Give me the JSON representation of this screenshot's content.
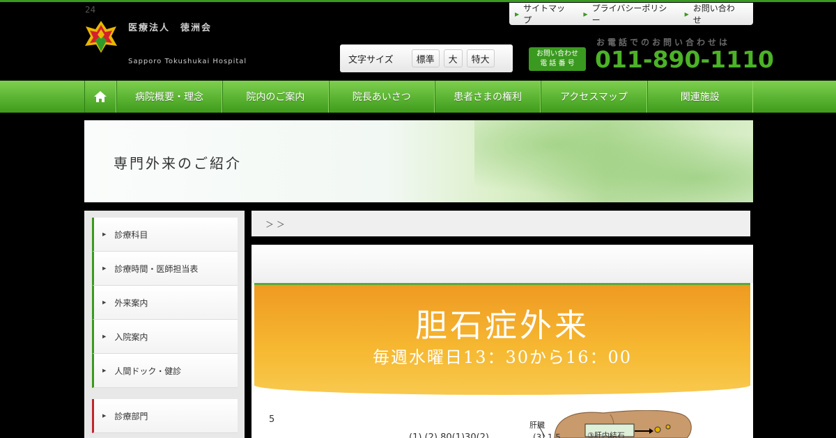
{
  "header": {
    "corner_number": "24",
    "org_name": "医療法人　徳洲会",
    "org_name_en": "Sapporo Tokushukai Hospital",
    "utility_links": [
      "サイトマップ",
      "プライバシーポリシー",
      "お問い合わせ"
    ],
    "font_size": {
      "label": "文字サイズ",
      "options": [
        "標準",
        "大",
        "特大"
      ]
    },
    "phone": {
      "badge_line1": "お問い合わせ",
      "badge_line2": "電 話 番 号",
      "caption": "お電話でのお問い合わせは",
      "number": "011-890-1110"
    }
  },
  "nav": {
    "home_icon": "home-icon",
    "items": [
      "病院概要・理念",
      "院内のご案内",
      "院長あいさつ",
      "患者さまの権利",
      "アクセスマップ",
      "関連施設"
    ]
  },
  "banner": {
    "title": "専門外来のご紹介"
  },
  "sidebar": {
    "group1": [
      "診療科目",
      "診療時間・医師担当表",
      "外来案内",
      "入院案内",
      "人間ドック・健診"
    ],
    "group2": [
      "診療部門"
    ]
  },
  "breadcrumb": "＞ ＞",
  "content": {
    "clinic_title": "胆石症外来",
    "clinic_time": "毎週水曜日13：30から16：00",
    "number": "5",
    "fragment_text": "(1) (2) 80(1)30(2)",
    "fragment_text2": "(3) 1.5",
    "diagram_label_liver": "肝臓",
    "diagram_label_stone": "③肝内結石"
  },
  "colors": {
    "brand_green": "#3a9a1f",
    "phone_green": "#4cb227",
    "clinic_orange": "#f6b932"
  }
}
